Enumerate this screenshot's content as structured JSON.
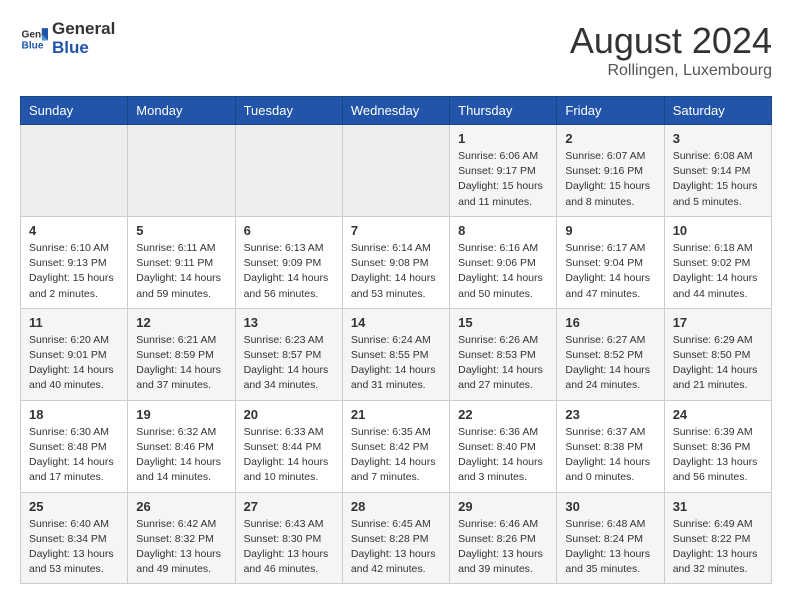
{
  "header": {
    "logo_general": "General",
    "logo_blue": "Blue",
    "title": "August 2024",
    "subtitle": "Rollingen, Luxembourg"
  },
  "days_of_week": [
    "Sunday",
    "Monday",
    "Tuesday",
    "Wednesday",
    "Thursday",
    "Friday",
    "Saturday"
  ],
  "weeks": [
    [
      {
        "day": "",
        "info": ""
      },
      {
        "day": "",
        "info": ""
      },
      {
        "day": "",
        "info": ""
      },
      {
        "day": "",
        "info": ""
      },
      {
        "day": "1",
        "info": "Sunrise: 6:06 AM\nSunset: 9:17 PM\nDaylight: 15 hours\nand 11 minutes."
      },
      {
        "day": "2",
        "info": "Sunrise: 6:07 AM\nSunset: 9:16 PM\nDaylight: 15 hours\nand 8 minutes."
      },
      {
        "day": "3",
        "info": "Sunrise: 6:08 AM\nSunset: 9:14 PM\nDaylight: 15 hours\nand 5 minutes."
      }
    ],
    [
      {
        "day": "4",
        "info": "Sunrise: 6:10 AM\nSunset: 9:13 PM\nDaylight: 15 hours\nand 2 minutes."
      },
      {
        "day": "5",
        "info": "Sunrise: 6:11 AM\nSunset: 9:11 PM\nDaylight: 14 hours\nand 59 minutes."
      },
      {
        "day": "6",
        "info": "Sunrise: 6:13 AM\nSunset: 9:09 PM\nDaylight: 14 hours\nand 56 minutes."
      },
      {
        "day": "7",
        "info": "Sunrise: 6:14 AM\nSunset: 9:08 PM\nDaylight: 14 hours\nand 53 minutes."
      },
      {
        "day": "8",
        "info": "Sunrise: 6:16 AM\nSunset: 9:06 PM\nDaylight: 14 hours\nand 50 minutes."
      },
      {
        "day": "9",
        "info": "Sunrise: 6:17 AM\nSunset: 9:04 PM\nDaylight: 14 hours\nand 47 minutes."
      },
      {
        "day": "10",
        "info": "Sunrise: 6:18 AM\nSunset: 9:02 PM\nDaylight: 14 hours\nand 44 minutes."
      }
    ],
    [
      {
        "day": "11",
        "info": "Sunrise: 6:20 AM\nSunset: 9:01 PM\nDaylight: 14 hours\nand 40 minutes."
      },
      {
        "day": "12",
        "info": "Sunrise: 6:21 AM\nSunset: 8:59 PM\nDaylight: 14 hours\nand 37 minutes."
      },
      {
        "day": "13",
        "info": "Sunrise: 6:23 AM\nSunset: 8:57 PM\nDaylight: 14 hours\nand 34 minutes."
      },
      {
        "day": "14",
        "info": "Sunrise: 6:24 AM\nSunset: 8:55 PM\nDaylight: 14 hours\nand 31 minutes."
      },
      {
        "day": "15",
        "info": "Sunrise: 6:26 AM\nSunset: 8:53 PM\nDaylight: 14 hours\nand 27 minutes."
      },
      {
        "day": "16",
        "info": "Sunrise: 6:27 AM\nSunset: 8:52 PM\nDaylight: 14 hours\nand 24 minutes."
      },
      {
        "day": "17",
        "info": "Sunrise: 6:29 AM\nSunset: 8:50 PM\nDaylight: 14 hours\nand 21 minutes."
      }
    ],
    [
      {
        "day": "18",
        "info": "Sunrise: 6:30 AM\nSunset: 8:48 PM\nDaylight: 14 hours\nand 17 minutes."
      },
      {
        "day": "19",
        "info": "Sunrise: 6:32 AM\nSunset: 8:46 PM\nDaylight: 14 hours\nand 14 minutes."
      },
      {
        "day": "20",
        "info": "Sunrise: 6:33 AM\nSunset: 8:44 PM\nDaylight: 14 hours\nand 10 minutes."
      },
      {
        "day": "21",
        "info": "Sunrise: 6:35 AM\nSunset: 8:42 PM\nDaylight: 14 hours\nand 7 minutes."
      },
      {
        "day": "22",
        "info": "Sunrise: 6:36 AM\nSunset: 8:40 PM\nDaylight: 14 hours\nand 3 minutes."
      },
      {
        "day": "23",
        "info": "Sunrise: 6:37 AM\nSunset: 8:38 PM\nDaylight: 14 hours\nand 0 minutes."
      },
      {
        "day": "24",
        "info": "Sunrise: 6:39 AM\nSunset: 8:36 PM\nDaylight: 13 hours\nand 56 minutes."
      }
    ],
    [
      {
        "day": "25",
        "info": "Sunrise: 6:40 AM\nSunset: 8:34 PM\nDaylight: 13 hours\nand 53 minutes."
      },
      {
        "day": "26",
        "info": "Sunrise: 6:42 AM\nSunset: 8:32 PM\nDaylight: 13 hours\nand 49 minutes."
      },
      {
        "day": "27",
        "info": "Sunrise: 6:43 AM\nSunset: 8:30 PM\nDaylight: 13 hours\nand 46 minutes."
      },
      {
        "day": "28",
        "info": "Sunrise: 6:45 AM\nSunset: 8:28 PM\nDaylight: 13 hours\nand 42 minutes."
      },
      {
        "day": "29",
        "info": "Sunrise: 6:46 AM\nSunset: 8:26 PM\nDaylight: 13 hours\nand 39 minutes."
      },
      {
        "day": "30",
        "info": "Sunrise: 6:48 AM\nSunset: 8:24 PM\nDaylight: 13 hours\nand 35 minutes."
      },
      {
        "day": "31",
        "info": "Sunrise: 6:49 AM\nSunset: 8:22 PM\nDaylight: 13 hours\nand 32 minutes."
      }
    ]
  ]
}
